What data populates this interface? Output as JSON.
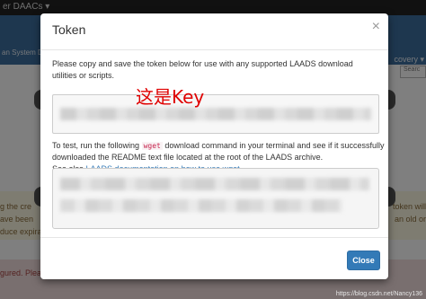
{
  "background": {
    "nav_brand": "er DAACs ▾",
    "subnav_left": "an System Dis",
    "subnav_right": "covery ▾",
    "search_placeholder": "Searc",
    "warn_left_1": "g the cre",
    "warn_left_2": "ave been",
    "warn_left_3": "duce expira",
    "warn_right_1": "token will",
    "warn_right_2": "an old or",
    "bottom_text": "gured. Pleas",
    "watermark": "https://blog.csdn.net/Nancy136"
  },
  "modal": {
    "title": "Token",
    "close_symbol": "×",
    "intro_text": "Please copy and save the token below for use with any supported LAADS download utilities or scripts.",
    "annotation": "这是Key",
    "test_text_before": "To test, run the following",
    "test_code": "wget",
    "test_text_after": "download command in your terminal and see if it successfully downloaded the README text file located at the root of the LAADS archive.",
    "see_also_prefix": "See also",
    "see_also_link": "LAADS documentation on how to use wget",
    "close_button": "Close"
  }
}
